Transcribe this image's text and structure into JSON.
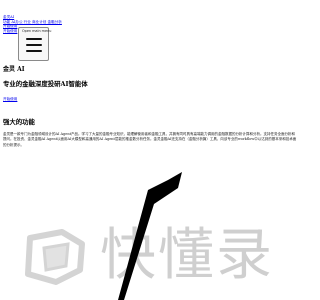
{
  "top_nav": {
    "links": [
      "金灵AI",
      "功能 AI办公 行业 商业计划 金融分析",
      "开始使用",
      "开始使用"
    ]
  },
  "menu_button": {
    "label": "Open main menu",
    "icon": "hamburger-icon"
  },
  "hero": {
    "title": "金灵 AI",
    "subtitle": "专业的金融深度投研AI智能体",
    "cta_label": "开始使用"
  },
  "features": {
    "heading": "强大的功能",
    "description": "金灵是一款专门为金融领域设计的AI Agent产品。学习了大量的金融专业知识，能理解使用者和金融工具，并拥有同时具有高端能力调用的金融数据的分析计算和分析。支持任务全面分析和提问。在投资、金灵金融AI Agent以面用AI大模型和高通用的AI Agent层能的推金数分析任务。金灵金融AI还支持在（金融分析篇）工具，向该专业的workflow中以达到的基本采和技术面的分析提示。"
  },
  "watermark": {
    "text": "快懂录",
    "logo_icon": "watermark-logo-icon",
    "color": "#cfcfcf"
  },
  "colors": {
    "link": "#0000ee",
    "text": "#000000",
    "arrow": "#000000"
  }
}
